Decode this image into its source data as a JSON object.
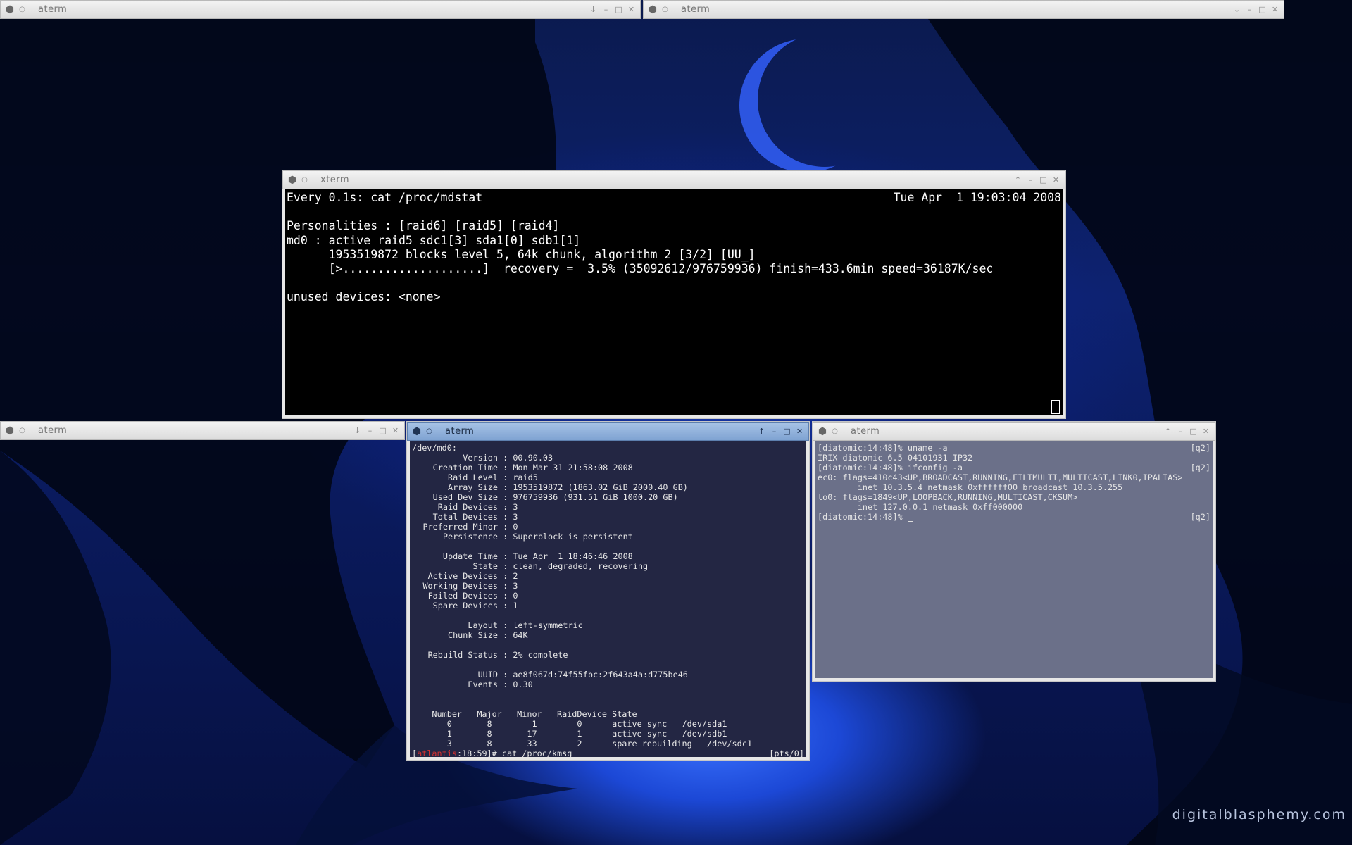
{
  "windows": {
    "top_left": {
      "title": "aterm"
    },
    "top_right": {
      "title": "aterm"
    },
    "bottom_left": {
      "title": "aterm"
    },
    "xterm": {
      "title": "xterm",
      "header_cmd": "Every 0.1s: cat /proc/mdstat",
      "header_time": "Tue Apr  1 19:03:04 2008",
      "lines": [
        "",
        "Personalities : [raid6] [raid5] [raid4]",
        "md0 : active raid5 sdc1[3] sda1[0] sdb1[1]",
        "      1953519872 blocks level 5, 64k chunk, algorithm 2 [3/2] [UU_]",
        "      [>....................]  recovery =  3.5% (35092612/976759936) finish=433.6min speed=36187K/sec",
        "",
        "unused devices: <none>"
      ]
    },
    "mdadm": {
      "title": "aterm",
      "device": "/dev/md0:",
      "fields": [
        [
          "Version",
          "00.90.03"
        ],
        [
          "Creation Time",
          "Mon Mar 31 21:58:08 2008"
        ],
        [
          "Raid Level",
          "raid5"
        ],
        [
          "Array Size",
          "1953519872 (1863.02 GiB 2000.40 GB)"
        ],
        [
          "Used Dev Size",
          "976759936 (931.51 GiB 1000.20 GB)"
        ],
        [
          "Raid Devices",
          "3"
        ],
        [
          "Total Devices",
          "3"
        ],
        [
          "Preferred Minor",
          "0"
        ],
        [
          "Persistence",
          "Superblock is persistent"
        ],
        [
          "",
          ""
        ],
        [
          "Update Time",
          "Tue Apr  1 18:46:46 2008"
        ],
        [
          "State",
          "clean, degraded, recovering"
        ],
        [
          "Active Devices",
          "2"
        ],
        [
          "Working Devices",
          "3"
        ],
        [
          "Failed Devices",
          "0"
        ],
        [
          "Spare Devices",
          "1"
        ],
        [
          "",
          ""
        ],
        [
          "Layout",
          "left-symmetric"
        ],
        [
          "Chunk Size",
          "64K"
        ],
        [
          "",
          ""
        ],
        [
          "Rebuild Status",
          "2% complete"
        ],
        [
          "",
          ""
        ],
        [
          "UUID",
          "ae8f067d:74f55fbc:2f643a4a:d775be46"
        ],
        [
          "Events",
          "0.30"
        ]
      ],
      "table_header": "    Number   Major   Minor   RaidDevice State",
      "table_rows": [
        "       0       8        1        0      active sync   /dev/sda1",
        "       1       8       17        1      active sync   /dev/sdb1",
        "       3       8       33        2      spare rebuilding   /dev/sdc1"
      ],
      "prompt_host": "atlantis",
      "prompt_rest": ":18:59]# cat /proc/kmsg",
      "prompt_open": "[",
      "prompt_tty": "[pts/0]"
    },
    "irix": {
      "title": "aterm",
      "lines": [
        {
          "text": "[diatomic:14:48]% uname -a",
          "right": "[q2]"
        },
        {
          "text": "IRIX diatomic 6.5 04101931 IP32",
          "right": ""
        },
        {
          "text": "[diatomic:14:48]% ifconfig -a",
          "right": "[q2]"
        },
        {
          "text": "ec0: flags=410c43<UP,BROADCAST,RUNNING,FILTMULTI,MULTICAST,LINK0,IPALIAS>",
          "right": ""
        },
        {
          "text": "        inet 10.3.5.4 netmask 0xffffff00 broadcast 10.3.5.255",
          "right": ""
        },
        {
          "text": "lo0: flags=1849<UP,LOOPBACK,RUNNING,MULTICAST,CKSUM>",
          "right": ""
        },
        {
          "text": "        inet 127.0.0.1 netmask 0xff000000",
          "right": ""
        },
        {
          "text": "[diatomic:14:48]% ",
          "right": "[q2]"
        }
      ]
    }
  },
  "watermark": "digitalblasphemy.com",
  "icons": {
    "window": "cube-icon",
    "sticky": "pin-icon",
    "shade": "shade-arrow-icon",
    "minimize": "minimize-icon",
    "maximize": "maximize-icon",
    "close": "close-icon"
  }
}
